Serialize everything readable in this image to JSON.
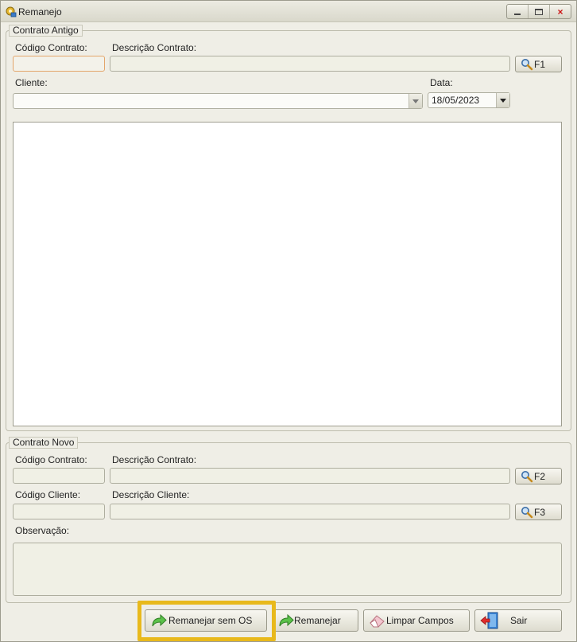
{
  "window": {
    "title": "Remanejo"
  },
  "contrato_antigo": {
    "legend": "Contrato Antigo",
    "codigo_label": "Código Contrato:",
    "codigo_value": "",
    "descricao_label": "Descrição Contrato:",
    "descricao_value": "",
    "search_button_label": "F1",
    "cliente_label": "Cliente:",
    "cliente_value": "",
    "data_label": "Data:",
    "data_value": "18/05/2023"
  },
  "contrato_novo": {
    "legend": "Contrato Novo",
    "codigo_contrato_label": "Código Contrato:",
    "codigo_contrato_value": "",
    "descricao_contrato_label": "Descrição Contrato:",
    "descricao_contrato_value": "",
    "search_contrato_label": "F2",
    "codigo_cliente_label": "Código Cliente:",
    "codigo_cliente_value": "",
    "descricao_cliente_label": "Descrição Cliente:",
    "descricao_cliente_value": "",
    "search_cliente_label": "F3",
    "observacao_label": "Observação:",
    "observacao_value": ""
  },
  "actions": {
    "remanejar_sem_os": "Remanejar sem OS",
    "remanejar": "Remanejar",
    "limpar_campos": "Limpar Campos",
    "sair": "Sair"
  },
  "colors": {
    "highlight": "#e8b91c",
    "active_field_border": "#e3a66b",
    "window_bg": "#efeee6"
  },
  "icons": {
    "search": "magnifier-icon",
    "remanejar": "green-arrow-icon",
    "limpar": "eraser-icon",
    "sair": "exit-door-icon"
  }
}
